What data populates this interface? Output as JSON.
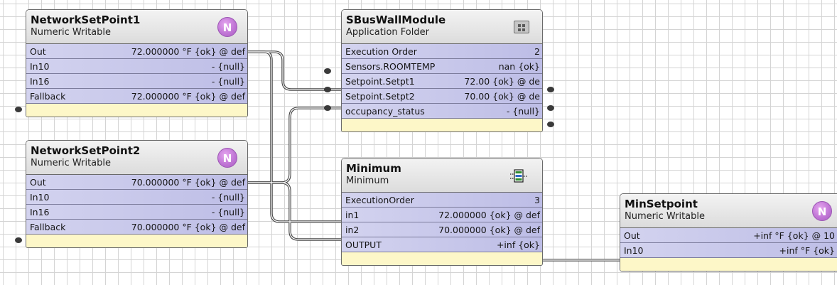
{
  "blocks": {
    "nsp1": {
      "title": "NetworkSetPoint1",
      "type": "Numeric Writable",
      "badge": "N",
      "slots": [
        {
          "name": "Out",
          "value": "72.000000 °F {ok} @ def"
        },
        {
          "name": "In10",
          "value": "- {null}"
        },
        {
          "name": "In16",
          "value": "- {null}"
        },
        {
          "name": "Fallback",
          "value": "72.000000 °F {ok} @ def"
        }
      ]
    },
    "nsp2": {
      "title": "NetworkSetPoint2",
      "type": "Numeric Writable",
      "badge": "N",
      "slots": [
        {
          "name": "Out",
          "value": "70.000000 °F {ok} @ def"
        },
        {
          "name": "In10",
          "value": "- {null}"
        },
        {
          "name": "In16",
          "value": "- {null}"
        },
        {
          "name": "Fallback",
          "value": "70.000000 °F {ok} @ def"
        }
      ]
    },
    "sbus": {
      "title": "SBusWallModule",
      "type": "Application Folder",
      "icon": "application-folder-icon",
      "slots": [
        {
          "name": "Execution Order",
          "value": "2"
        },
        {
          "name": "Sensors.ROOMTEMP",
          "value": "nan {ok}"
        },
        {
          "name": "Setpoint.Setpt1",
          "value": "72.00 {ok} @ de"
        },
        {
          "name": "Setpoint.Setpt2",
          "value": "70.00 {ok} @ de"
        },
        {
          "name": "occupancy_status",
          "value": "- {null}"
        }
      ]
    },
    "minimum": {
      "title": "Minimum",
      "type": "Minimum",
      "icon": "minimum-icon",
      "slots": [
        {
          "name": "ExecutionOrder",
          "value": "3"
        },
        {
          "name": "in1",
          "value": "72.000000 {ok} @ def"
        },
        {
          "name": "in2",
          "value": "70.000000 {ok} @ def"
        },
        {
          "name": "OUTPUT",
          "value": "+inf {ok}"
        }
      ]
    },
    "minsp": {
      "title": "MinSetpoint",
      "type": "Numeric Writable",
      "badge": "N",
      "slots": [
        {
          "name": "Out",
          "value": "+inf °F {ok} @ 10"
        },
        {
          "name": "In10",
          "value": "+inf °F {ok}"
        }
      ]
    }
  },
  "colors": {
    "slot_row": "#c9c9ec",
    "footer": "#fdf7c8",
    "badge": "#c177d6",
    "wire": "#444444"
  }
}
